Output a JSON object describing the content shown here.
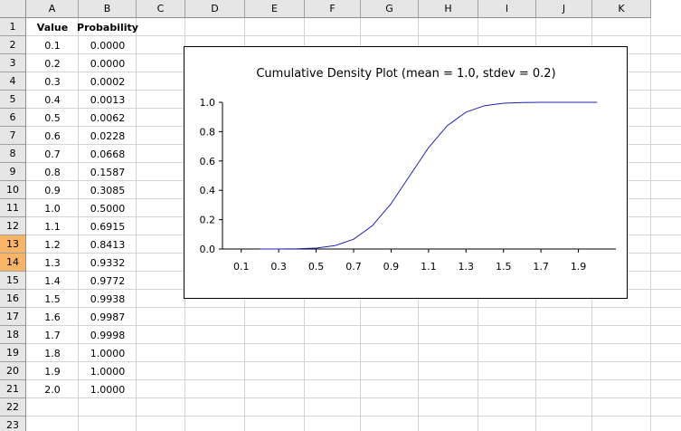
{
  "columns": [
    "A",
    "B",
    "C",
    "D",
    "E",
    "F",
    "G",
    "H",
    "I",
    "J",
    "K"
  ],
  "rows": [
    "1",
    "2",
    "3",
    "4",
    "5",
    "6",
    "7",
    "8",
    "9",
    "10",
    "11",
    "12",
    "13",
    "14",
    "15",
    "16",
    "17",
    "18",
    "19",
    "20",
    "21",
    "22",
    "23"
  ],
  "selected_rows": [
    "13",
    "14"
  ],
  "table": {
    "headers": [
      "Value",
      "Probability"
    ],
    "rows": [
      [
        "0.1",
        "0.0000"
      ],
      [
        "0.2",
        "0.0000"
      ],
      [
        "0.3",
        "0.0002"
      ],
      [
        "0.4",
        "0.0013"
      ],
      [
        "0.5",
        "0.0062"
      ],
      [
        "0.6",
        "0.0228"
      ],
      [
        "0.7",
        "0.0668"
      ],
      [
        "0.8",
        "0.1587"
      ],
      [
        "0.9",
        "0.3085"
      ],
      [
        "1.0",
        "0.5000"
      ],
      [
        "1.1",
        "0.6915"
      ],
      [
        "1.2",
        "0.8413"
      ],
      [
        "1.3",
        "0.9332"
      ],
      [
        "1.4",
        "0.9772"
      ],
      [
        "1.5",
        "0.9938"
      ],
      [
        "1.6",
        "0.9987"
      ],
      [
        "1.7",
        "0.9998"
      ],
      [
        "1.8",
        "1.0000"
      ],
      [
        "1.9",
        "1.0000"
      ],
      [
        "2.0",
        "1.0000"
      ]
    ]
  },
  "chart_data": {
    "type": "line",
    "title": "Cumulative Density Plot (mean = 1.0, stdev = 0.2)",
    "x": [
      0.1,
      0.2,
      0.3,
      0.4,
      0.5,
      0.6,
      0.7,
      0.8,
      0.9,
      1.0,
      1.1,
      1.2,
      1.3,
      1.4,
      1.5,
      1.6,
      1.7,
      1.8,
      1.9,
      2.0
    ],
    "series": [
      {
        "values": [
          0.0,
          0.0,
          0.0002,
          0.0013,
          0.0062,
          0.0228,
          0.0668,
          0.1587,
          0.3085,
          0.5,
          0.6915,
          0.8413,
          0.9332,
          0.9772,
          0.9938,
          0.9987,
          0.9998,
          1.0,
          1.0,
          1.0
        ],
        "color": "#1f1fb4"
      }
    ],
    "xticks": [
      "0.1",
      "0.3",
      "0.5",
      "0.7",
      "0.9",
      "1.1",
      "1.3",
      "1.5",
      "1.7",
      "1.9"
    ],
    "yticks": [
      "0.0",
      "0.2",
      "0.4",
      "0.6",
      "0.8",
      "1.0"
    ],
    "ylim": [
      0,
      1.0
    ],
    "grid": false,
    "axis_color": "#000000"
  }
}
